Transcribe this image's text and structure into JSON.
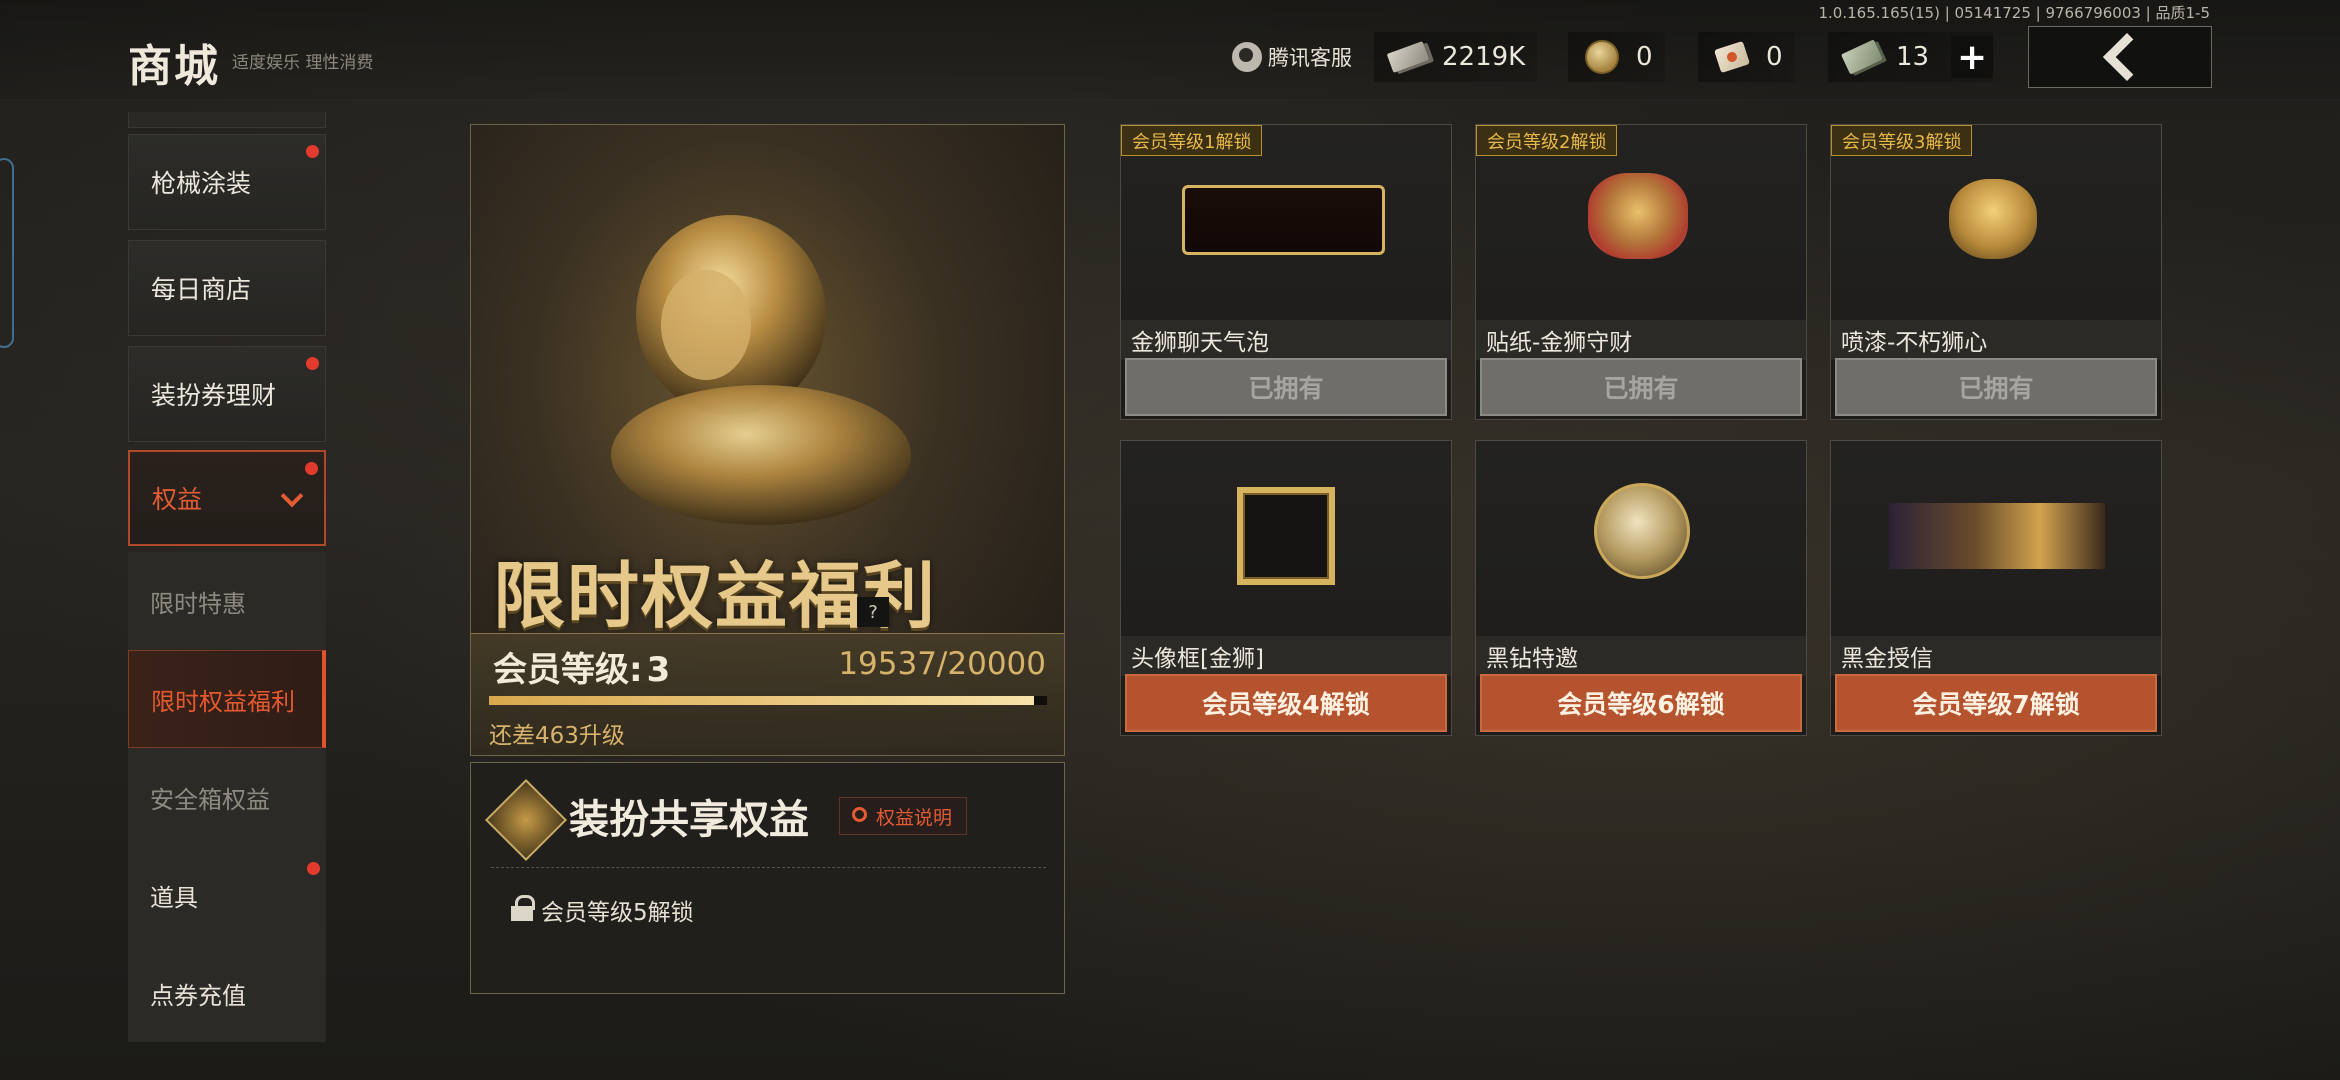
{
  "header": {
    "title": "商城",
    "subtitle": "适度娱乐 理性消费",
    "version": "1.0.165.165(15) | 05141725 | 9766796003 | 品质1-5",
    "customer_service": "腾讯客服",
    "currencies": [
      {
        "icon": "cash-icon",
        "value": "2219K"
      },
      {
        "icon": "coin-icon",
        "value": "0"
      },
      {
        "icon": "ticket-icon",
        "value": "0"
      },
      {
        "icon": "bill-icon",
        "value": "13"
      }
    ],
    "plus": "+"
  },
  "sidebar": {
    "items": [
      {
        "label": "枪械涂装",
        "badge": true
      },
      {
        "label": "每日商店",
        "badge": false
      },
      {
        "label": "装扮券理财",
        "badge": true
      },
      {
        "label": "权益",
        "badge": true,
        "expanded": true
      },
      {
        "label": "道具",
        "badge": true
      },
      {
        "label": "点券充值",
        "badge": false
      }
    ],
    "sub_items": [
      {
        "label": "限时特惠",
        "active": false
      },
      {
        "label": "限时权益福利",
        "active": true
      },
      {
        "label": "安全箱权益",
        "active": false
      }
    ]
  },
  "banner": {
    "title": "限时权益福利",
    "help": "?",
    "level_label": "会员等级:",
    "level_value": "3",
    "exp_text": "19537/20000",
    "exp_current": 19537,
    "exp_max": 20000,
    "remaining": "还差463升级"
  },
  "shared_rights": {
    "title": "装扮共享权益",
    "explain_button": "权益说明",
    "lock_text": "会员等级5解锁"
  },
  "cards": [
    {
      "tag": "会员等级1解锁",
      "name": "金狮聊天气泡",
      "button": "已拥有",
      "state": "owned",
      "icon": "chat-bubble-icon"
    },
    {
      "tag": "会员等级2解锁",
      "name": "贴纸-金狮守财",
      "button": "已拥有",
      "state": "owned",
      "icon": "sticker-icon"
    },
    {
      "tag": "会员等级3解锁",
      "name": "喷漆-不朽狮心",
      "button": "已拥有",
      "state": "owned",
      "icon": "spray-icon"
    },
    {
      "tag": "",
      "name": "头像框[金狮]",
      "button": "会员等级4解锁",
      "state": "locked",
      "icon": "avatar-frame-icon"
    },
    {
      "tag": "",
      "name": "黑钻特邀",
      "button": "会员等级6解锁",
      "state": "locked",
      "icon": "helmet-badge-icon"
    },
    {
      "tag": "",
      "name": "黑金授信",
      "button": "会员等级7解锁",
      "state": "locked",
      "icon": "card-banner-icon"
    }
  ]
}
